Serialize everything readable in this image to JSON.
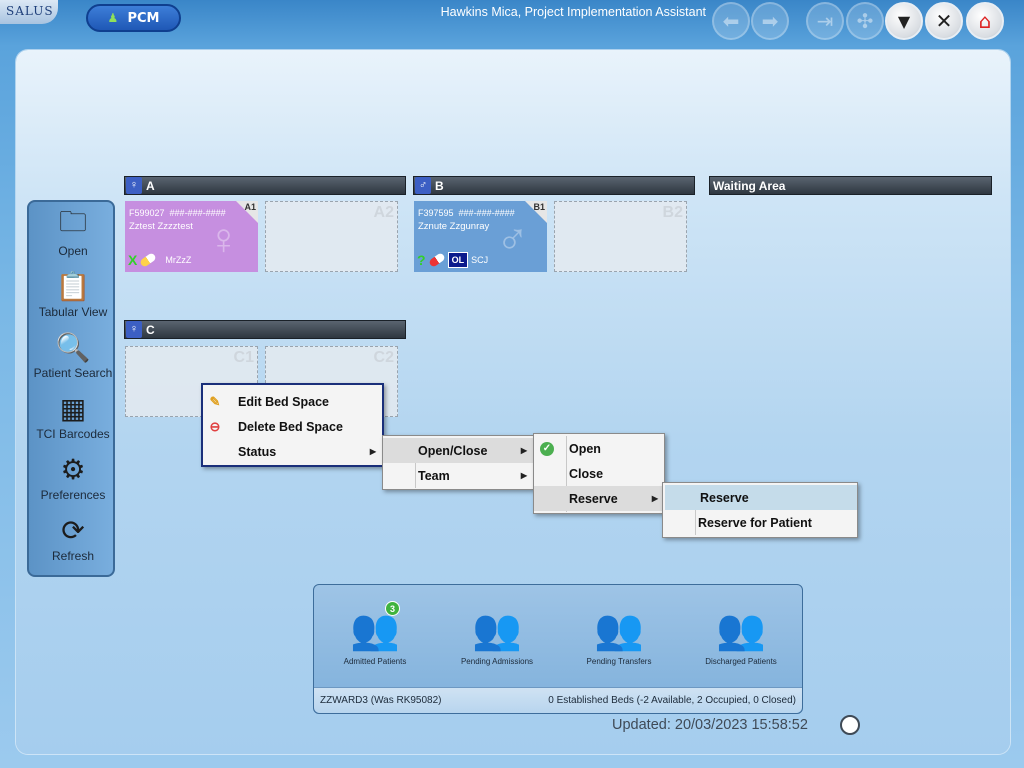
{
  "topbar": {
    "logo_text": "SALUS",
    "pcm_label": "PCM",
    "user_title": "Hawkins Mica, Project Implementation Assistant",
    "buttons": [
      {
        "name": "back-arrow-icon",
        "glyph": "⬅"
      },
      {
        "name": "forward-arrow-icon",
        "glyph": "➡"
      },
      {
        "name": "logout-door-icon",
        "glyph": "⇥"
      },
      {
        "name": "network-icon",
        "glyph": "✣"
      },
      {
        "name": "filter-funnel-icon",
        "glyph": "▼"
      },
      {
        "name": "close-icon",
        "glyph": "✕"
      },
      {
        "name": "home-icon",
        "glyph": "⌂"
      }
    ]
  },
  "sidebar": {
    "items": [
      {
        "label": "Open",
        "icon": "folder-open-icon",
        "glyph": "🗀"
      },
      {
        "label": "Tabular View",
        "icon": "clipboard-icon",
        "glyph": "📋"
      },
      {
        "label": "Patient Search",
        "icon": "search-icon",
        "glyph": "🔍"
      },
      {
        "label": "TCI Barcodes",
        "icon": "qr-code-icon",
        "glyph": "▦"
      },
      {
        "label": "Preferences",
        "icon": "gear-icon",
        "glyph": "⚙"
      },
      {
        "label": "Refresh",
        "icon": "refresh-icon",
        "glyph": "⟳"
      }
    ]
  },
  "bays": [
    {
      "label": "A"
    },
    {
      "label": "B"
    },
    {
      "label": "Waiting Area"
    },
    {
      "label": "C"
    }
  ],
  "beds": {
    "A1": {
      "code": "A1",
      "id": "F599027",
      "nhs": "###-###-####",
      "name": "Zztest Zzzztest",
      "initials": "MrZzZ",
      "status_mark": "X"
    },
    "A2": {
      "code": "A2"
    },
    "B1": {
      "code": "B1",
      "id": "F397595",
      "nhs": "###-###-####",
      "name": "Zznute Zzgunray",
      "initials": "SCJ",
      "status_mark": "?",
      "badge": "OL"
    },
    "B2": {
      "code": "B2"
    },
    "C1": {
      "code": "C1"
    },
    "C2": {
      "code": "C2"
    }
  },
  "context_menu": {
    "items": [
      {
        "label": "Edit Bed Space",
        "icon": "pencil-icon"
      },
      {
        "label": "Delete Bed Space",
        "icon": "delete-icon"
      },
      {
        "label": "Status",
        "icon": ""
      }
    ]
  },
  "status_submenu": {
    "items": [
      {
        "label": "Open/Close"
      },
      {
        "label": "Team"
      }
    ]
  },
  "openclose_submenu": {
    "items": [
      {
        "label": "Open",
        "icon": "check-icon"
      },
      {
        "label": "Close",
        "icon": ""
      },
      {
        "label": "Reserve",
        "icon": ""
      }
    ]
  },
  "reserve_submenu": {
    "items": [
      {
        "label": "Reserve"
      },
      {
        "label": "Reserve for Patient"
      }
    ]
  },
  "dock": {
    "items": [
      {
        "label": "Admitted Patients",
        "badge": "3"
      },
      {
        "label": "Pending Admissions",
        "badge": ""
      },
      {
        "label": "Pending Transfers",
        "badge": ""
      },
      {
        "label": "Discharged Patients",
        "badge": ""
      }
    ],
    "ward": "ZZWARD3 (Was RK95082)",
    "beds_summary": "0 Established Beds (-2 Available, 2 Occupied, 0 Closed)"
  },
  "updated_text": "Updated: 20/03/2023 15:58:52"
}
